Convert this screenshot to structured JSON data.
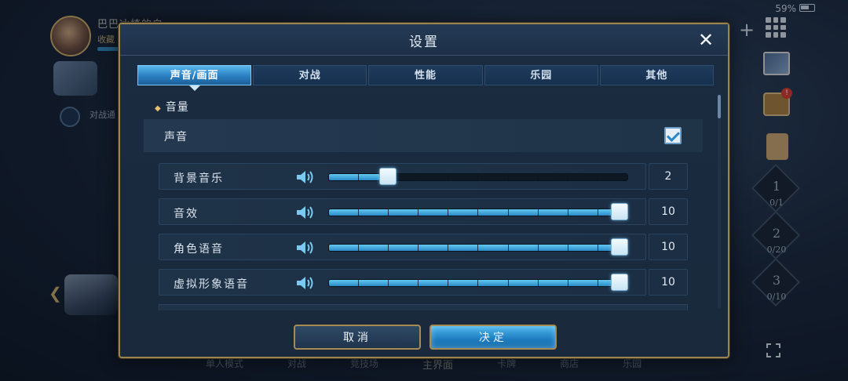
{
  "status_bar": {
    "battery": "59%"
  },
  "background": {
    "player_name": "巴巴冰楂的白",
    "player_badge": "收藏",
    "battle_text": "对战通",
    "stages": [
      {
        "num": "1",
        "count": "0/1"
      },
      {
        "num": "2",
        "count": "0/20"
      },
      {
        "num": "3",
        "count": "0/10"
      }
    ],
    "bottom_nav": [
      "单人模式",
      "对战",
      "竞技场",
      "主界面",
      "卡牌",
      "商店",
      "乐园"
    ],
    "gift_badge": "!"
  },
  "modal": {
    "title": "设置",
    "close_icon": "close-icon",
    "tabs": [
      "声音/画面",
      "对战",
      "性能",
      "乐园",
      "其他"
    ],
    "active_tab": 0,
    "section_title": "音量",
    "sound_label": "声音",
    "sound_enabled": true,
    "volume_rows": [
      {
        "label": "背景音乐",
        "value": "2",
        "level": 2,
        "max": 10
      },
      {
        "label": "音效",
        "value": "10",
        "level": 10,
        "max": 10
      },
      {
        "label": "角色语音",
        "value": "10",
        "level": 10,
        "max": 10
      },
      {
        "label": "虚拟形象语音",
        "value": "10",
        "level": 10,
        "max": 10
      }
    ],
    "cancel_label": "取消",
    "confirm_label": "决定"
  },
  "colors": {
    "accent": "#2a8ac8",
    "frame_gold": "#9a8450",
    "active_tab": "#3a9ad8"
  }
}
